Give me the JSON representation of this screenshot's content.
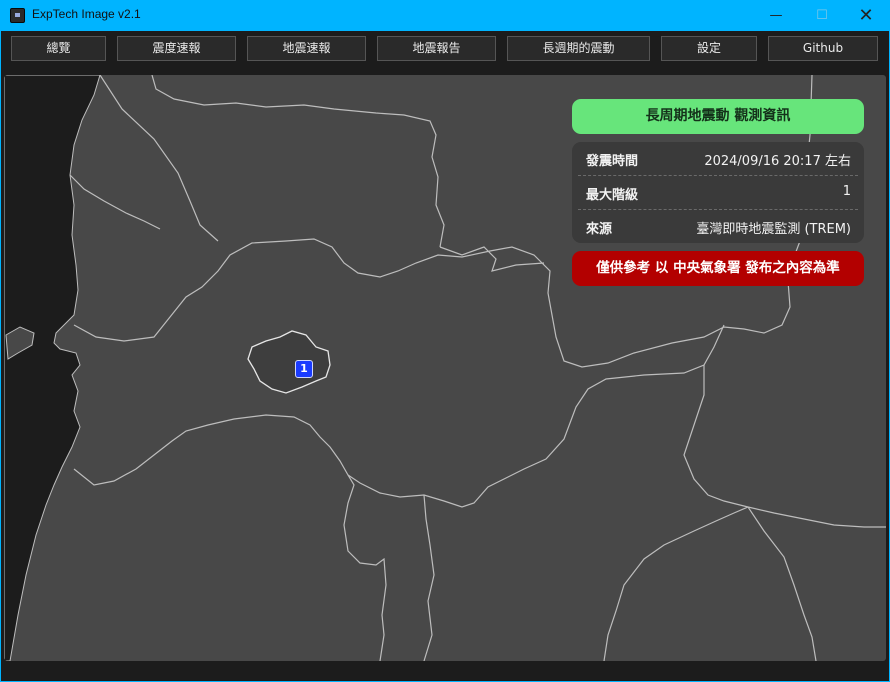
{
  "window": {
    "title": "ExpTech Image v2.1",
    "controls": {
      "minimize": "—",
      "maximize": "☐",
      "close": "✕"
    }
  },
  "toolbar": {
    "items": [
      {
        "label": "總覽"
      },
      {
        "label": "震度速報"
      },
      {
        "label": "地震速報"
      },
      {
        "label": "地震報告"
      },
      {
        "label": "長週期的震動"
      },
      {
        "label": "設定"
      },
      {
        "label": "Github"
      }
    ]
  },
  "panel": {
    "title": "長周期地震動 觀測資訊",
    "rows": [
      {
        "key": "發震時間",
        "value": "2024/09/16 20:17 左右"
      },
      {
        "key": "最大階級",
        "value": "1"
      },
      {
        "key": "來源",
        "value": "臺灣即時地震監測 (TREM)"
      }
    ],
    "warning": "僅供參考 以 中央氣象署 發布之內容為準"
  },
  "map": {
    "marker_label": "1",
    "colors": {
      "land": "#484848",
      "sea": "#1c1c1c",
      "border": "#bdbdbd",
      "highlight": "#2e2e2e",
      "marker": "#1a3bff"
    }
  },
  "colors": {
    "accent": "#00b4ff",
    "title_green": "#67e57b",
    "warning_red": "#b30000"
  }
}
